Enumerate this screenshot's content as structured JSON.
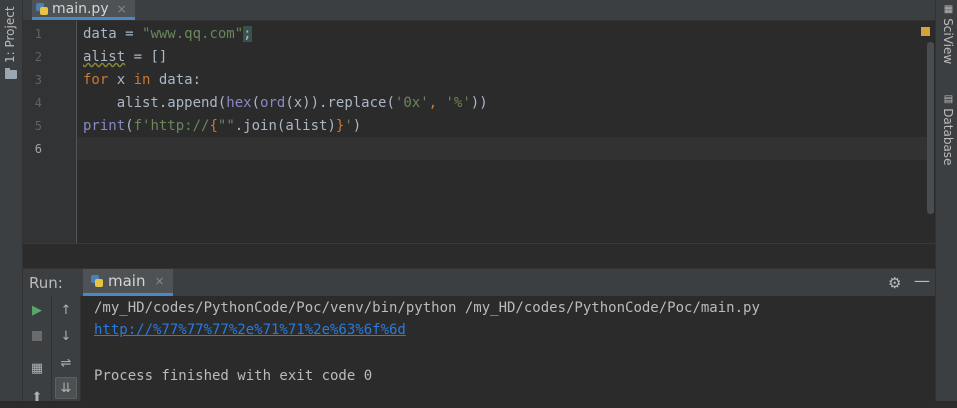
{
  "left_strip": {
    "project_label": "1: Project"
  },
  "right_strip": {
    "sciview_label": "SciView",
    "database_label": "Database"
  },
  "editor": {
    "tab_label": "main.py",
    "tab_close": "×",
    "line_numbers": [
      "1",
      "2",
      "3",
      "4",
      "5",
      "6"
    ],
    "lines": [
      [
        {
          "t": "data = ",
          "c": ""
        },
        {
          "t": "\"www.qq.com\"",
          "c": "str"
        },
        {
          "t": ";",
          "c": "hl-sel"
        }
      ],
      [
        {
          "t": "alist",
          "c": "warn-underline"
        },
        {
          "t": " = []",
          "c": ""
        }
      ],
      [
        {
          "t": "for",
          "c": "kw"
        },
        {
          "t": " x ",
          "c": ""
        },
        {
          "t": "in",
          "c": "kw"
        },
        {
          "t": " data:",
          "c": ""
        }
      ],
      [
        {
          "t": "    alist.append(",
          "c": ""
        },
        {
          "t": "hex",
          "c": "bi"
        },
        {
          "t": "(",
          "c": ""
        },
        {
          "t": "ord",
          "c": "bi"
        },
        {
          "t": "(x)).replace(",
          "c": ""
        },
        {
          "t": "'0x'",
          "c": "str"
        },
        {
          "t": ", ",
          "c": "kw"
        },
        {
          "t": "'%'",
          "c": "str"
        },
        {
          "t": "))",
          "c": ""
        }
      ],
      [
        {
          "t": "print",
          "c": "bi"
        },
        {
          "t": "(",
          "c": ""
        },
        {
          "t": "f'http://",
          "c": "str"
        },
        {
          "t": "{",
          "c": "kw"
        },
        {
          "t": "\"\"",
          "c": "str"
        },
        {
          "t": ".join(alist)",
          "c": ""
        },
        {
          "t": "}",
          "c": "kw"
        },
        {
          "t": "'",
          "c": "str"
        },
        {
          "t": ")",
          "c": ""
        }
      ],
      []
    ]
  },
  "run_panel": {
    "title": "Run:",
    "tab_label": "main",
    "tab_close": "×",
    "settings_icon": "gear-icon",
    "minimize_label": "—"
  },
  "console": {
    "command": "/my_HD/codes/PythonCode/Poc/venv/bin/python /my_HD/codes/PythonCode/Poc/main.py",
    "output_link": "http://%77%77%77%2e%71%71%2e%63%6f%6d",
    "exit_message": "Process finished with exit code 0"
  },
  "toolbar_icons": {
    "rerun": "▶",
    "up": "↑",
    "down": "↓",
    "soft_wrap": "⇌",
    "scroll_end": "⇊",
    "layout": "▦",
    "pin": "⬆"
  },
  "colors": {
    "background": "#2b2b2b",
    "keyword": "#cc7832",
    "string": "#6a8759",
    "builtin": "#8888c6",
    "link": "#287bde",
    "accent": "#4a88c7"
  }
}
